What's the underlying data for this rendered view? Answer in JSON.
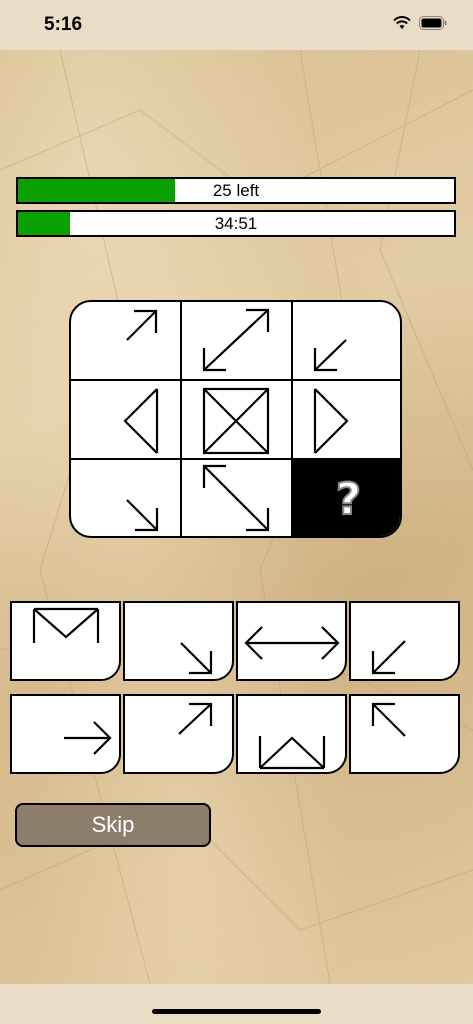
{
  "status": {
    "time": "5:16"
  },
  "progress": {
    "label": "25 left",
    "fill_fraction": 0.36
  },
  "timer": {
    "label": "34:51",
    "fill_fraction": 0.12
  },
  "grid": {
    "question_mark": "?"
  },
  "skip": {
    "label": "Skip"
  },
  "colors": {
    "bar_fill": "#0aa000",
    "skip_bg": "#8d7e6c"
  }
}
